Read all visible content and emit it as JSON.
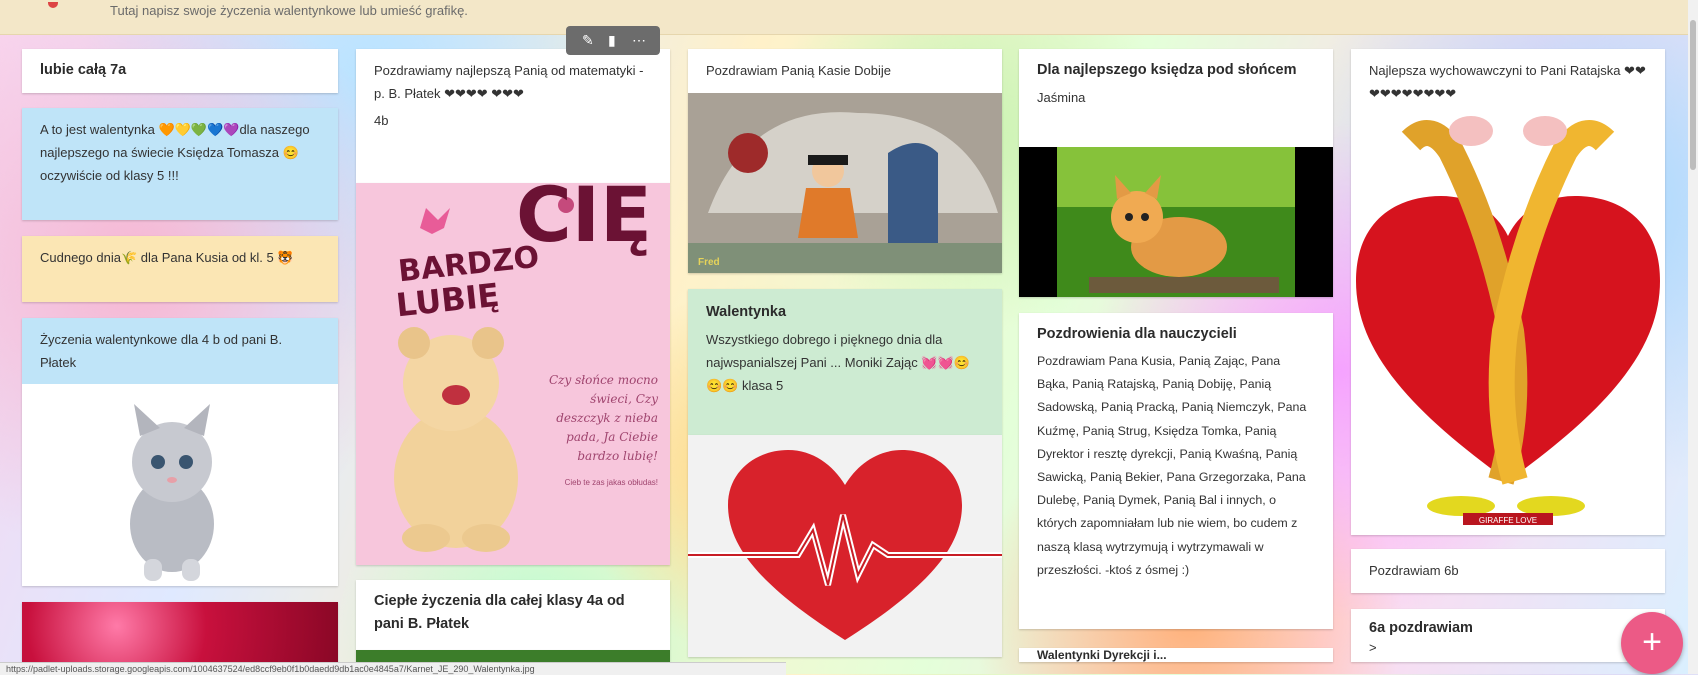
{
  "topbar": {
    "hint": "Tutaj napisz swoje życzenia walentynkowe lub umieść grafikę."
  },
  "toolbar": {
    "edit_icon": "pencil-icon",
    "delete_icon": "trash-icon",
    "more_icon": "more-icon"
  },
  "col1": {
    "p1_title": "lubie całą 7a",
    "p2_text": "A to jest walentynka 🧡💛💚💙💜dla naszego najlepszego na świecie Księdza Tomasza 😊 oczywiście od klasy 5 !!!",
    "p3_text": "Cudnego dnia🌾 dla Pana Kusia od kl. 5 🐯",
    "p4_text": "Życzenia walentynkowe dla 4 b od pani B. Płatek"
  },
  "col2": {
    "p1_text": "Pozdrawiamy najlepszą Panią od matematyki - p. B. Płatek ❤❤❤❤ ❤❤❤",
    "p1_sub": "4b",
    "card_word1": "BARDZO",
    "card_word2": "LUBIĘ",
    "card_word3": "CIĘ",
    "card_poem": "Czy słońce mocno świeci, Czy deszczyk z nieba pada, Ja Ciebie bardzo lubię!",
    "card_small": "Cieb te zas jakas obłudas!",
    "p2_title": "Ciepłe życzenia dla całej klasy 4a od pani B. Płatek"
  },
  "col3": {
    "p1_text": "Pozdrawiam Panią Kasie Dobije",
    "cartoon_logo": "Fred",
    "p2_title": "Walentynka",
    "p2_text": "Wszystkiego dobrego i pięknego dnia dla najwspanialszej Pani ... Moniki Zając 💓💓😊😊😊 klasa 5"
  },
  "col4": {
    "p1_title": "Dla najlepszego księdza pod słońcem",
    "p1_sub": "Jaśmina",
    "p2_title": "Pozdrowienia dla nauczycieli",
    "p2_text": "Pozdrawiam Pana Kusia, Panią Zając, Pana Bąka, Panią Ratajską, Panią Dobiję, Panią Sadowską, Panią Pracką, Panią Niemczyk, Pana Kuźmę, Panią Strug, Księdza Tomka, Panią Dyrektor i resztę dyrekcji, Panią Kwaśną, Panią Sawicką, Panią Bekier, Pana Grzegorzaka, Pana Dulebę, Panią Dymek, Panią Bal i innych, o których zapomniałam lub nie wiem, bo cudem z naszą klasą wytrzymują i wytrzymawali w przeszłości. -ktoś z ósmej :)",
    "p3_title": "Walentynki Dyrekcji i..."
  },
  "col5": {
    "p1_text": "Najlepsza wychowawczyni to Pani Ratajska ❤❤❤❤❤❤❤❤❤❤",
    "giraffe_caption": "GIRAFFE LOVE",
    "p2_text": "Pozdrawiam 6b",
    "p3_title": "6a pozdrawiam",
    "p3_sub": ">"
  },
  "fab": {
    "label": "+"
  },
  "statusbar": {
    "url": "https://padlet-uploads.storage.googleapis.com/1004637524/ed8ccf9eb0f1b0daedd9db1ac0e4845a7/Karnet_JE_290_Walentynka.jpg"
  }
}
